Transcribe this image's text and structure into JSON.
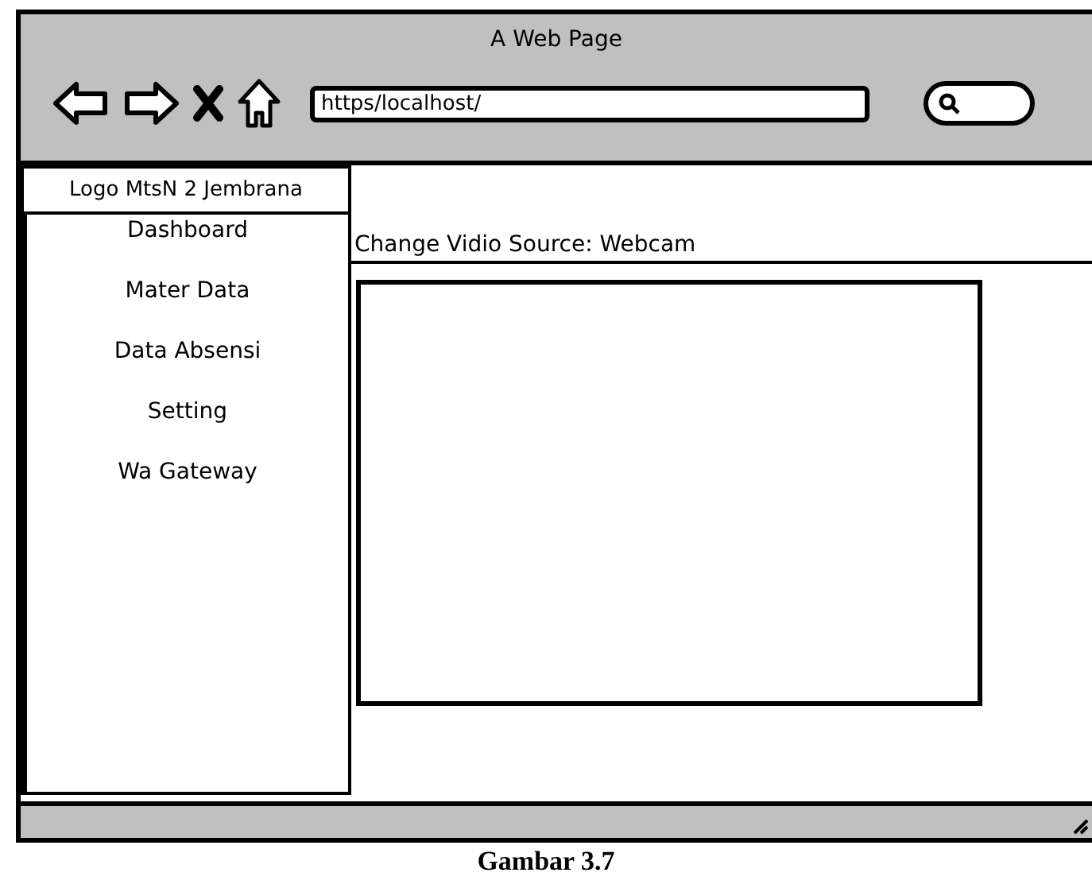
{
  "window": {
    "title": "A Web Page"
  },
  "address_bar": {
    "value": "https/localhost/"
  },
  "sidebar": {
    "logo": "Logo MtsN 2 Jembrana",
    "items": [
      {
        "label": "Dashboard"
      },
      {
        "label": "Mater Data"
      },
      {
        "label": "Data Absensi"
      },
      {
        "label": "Setting"
      },
      {
        "label": "Wa Gateway"
      }
    ]
  },
  "main": {
    "source_label": "Change Vidio Source: Webcam"
  },
  "caption": "Gambar 3.7"
}
